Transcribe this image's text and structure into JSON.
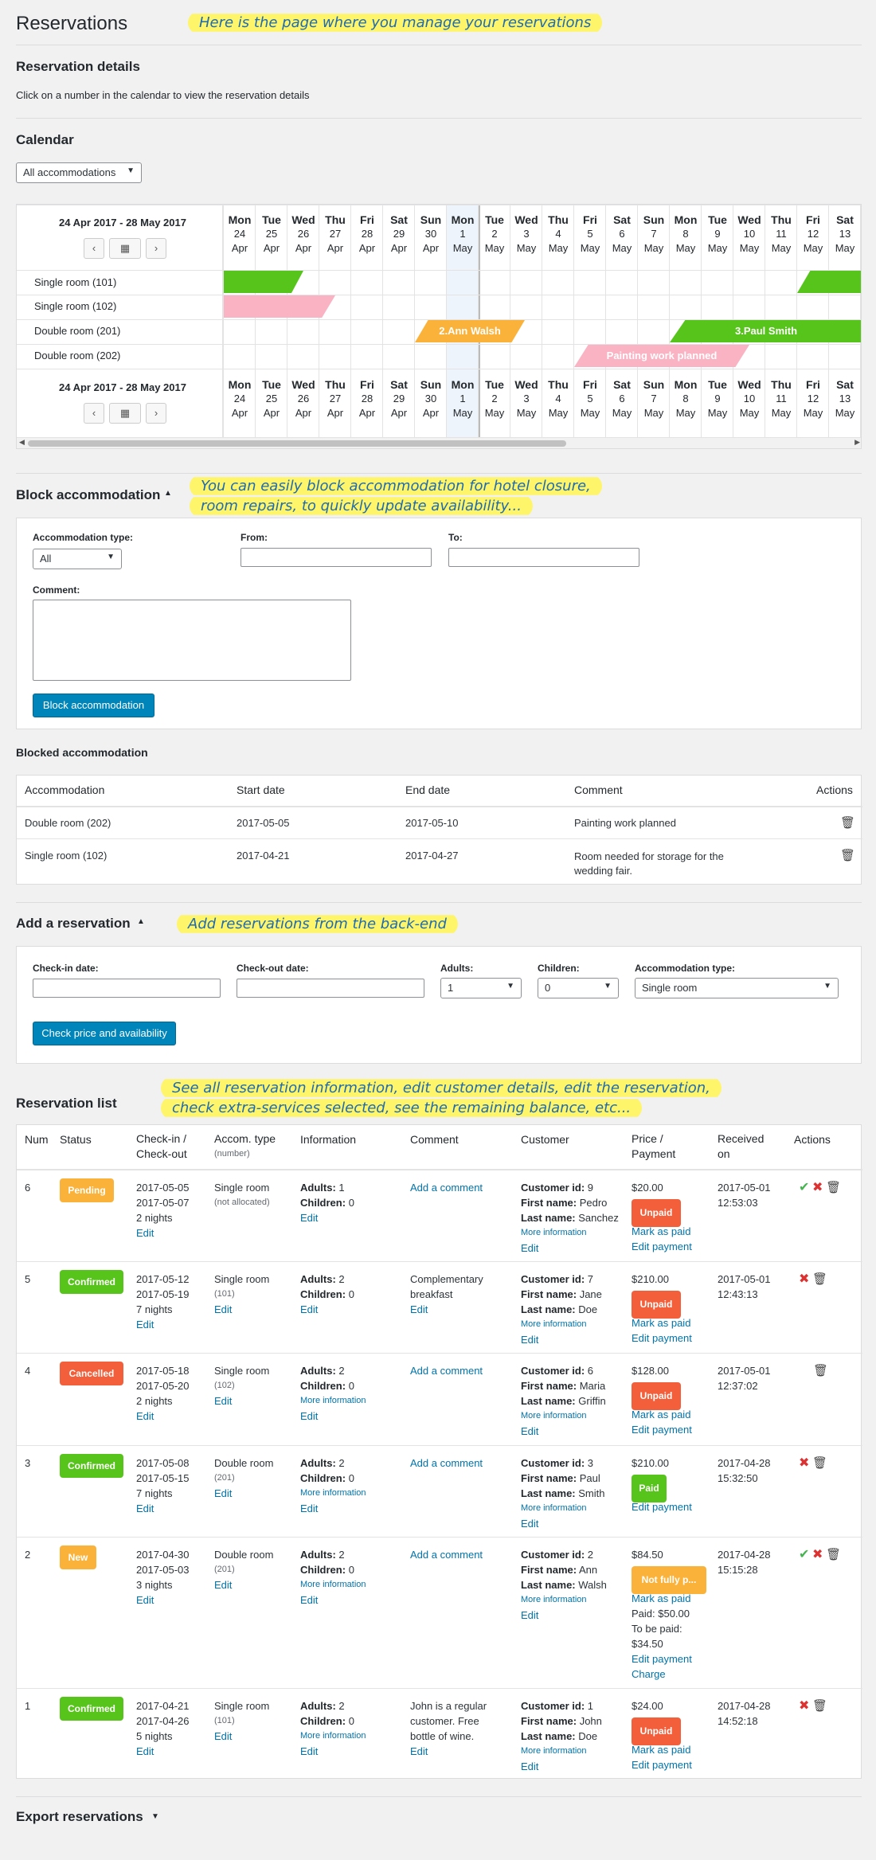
{
  "page": {
    "title": "Reservations",
    "title_note": "Here is the page where you manage your reservations"
  },
  "details": {
    "heading": "Reservation details",
    "hint": "Click on a number in the calendar to view the reservation details"
  },
  "calendar": {
    "heading": "Calendar",
    "filter": "All accommodations",
    "range": "24 Apr 2017 - 28 May 2017",
    "prev": "‹",
    "next": "›",
    "days": [
      {
        "dow": "Mon",
        "day": "24",
        "mon": "Apr"
      },
      {
        "dow": "Tue",
        "day": "25",
        "mon": "Apr"
      },
      {
        "dow": "Wed",
        "day": "26",
        "mon": "Apr"
      },
      {
        "dow": "Thu",
        "day": "27",
        "mon": "Apr"
      },
      {
        "dow": "Fri",
        "day": "28",
        "mon": "Apr"
      },
      {
        "dow": "Sat",
        "day": "29",
        "mon": "Apr"
      },
      {
        "dow": "Sun",
        "day": "30",
        "mon": "Apr"
      },
      {
        "dow": "Mon",
        "day": "1",
        "mon": "May"
      },
      {
        "dow": "Tue",
        "day": "2",
        "mon": "May"
      },
      {
        "dow": "Wed",
        "day": "3",
        "mon": "May"
      },
      {
        "dow": "Thu",
        "day": "4",
        "mon": "May"
      },
      {
        "dow": "Fri",
        "day": "5",
        "mon": "May"
      },
      {
        "dow": "Sat",
        "day": "6",
        "mon": "May"
      },
      {
        "dow": "Sun",
        "day": "7",
        "mon": "May"
      },
      {
        "dow": "Mon",
        "day": "8",
        "mon": "May"
      },
      {
        "dow": "Tue",
        "day": "9",
        "mon": "May"
      },
      {
        "dow": "Wed",
        "day": "10",
        "mon": "May"
      },
      {
        "dow": "Thu",
        "day": "11",
        "mon": "May"
      },
      {
        "dow": "Fri",
        "day": "12",
        "mon": "May"
      },
      {
        "dow": "Sat",
        "day": "13",
        "mon": "May"
      }
    ],
    "rooms": [
      "Single room (101)",
      "Single room (102)",
      "Double room (201)",
      "Double room (202)"
    ],
    "bar_labels": {
      "ann": "2.Ann Walsh",
      "paul": "3.Paul Smith",
      "painting": "Painting work planned"
    },
    "colors": {
      "green": "#56c41a",
      "pink": "#f9b3c2",
      "orange": "#fbb23a",
      "today": "#eef4fb"
    }
  },
  "block": {
    "heading": "Block accommodation",
    "note_line1": "You can easily block accommodation for hotel closure,",
    "note_line2": "room repairs, to quickly update availability...",
    "type_label": "Accommodation type:",
    "type_value": "All",
    "from_label": "From:",
    "to_label": "To:",
    "comment_label": "Comment:",
    "button": "Block accommodation"
  },
  "blocked": {
    "heading": "Blocked accommodation",
    "headers": [
      "Accommodation",
      "Start date",
      "End date",
      "Comment",
      "Actions"
    ],
    "rows": [
      {
        "acc": "Double room (202)",
        "start": "2017-05-05",
        "end": "2017-05-10",
        "comment1": "Painting work planned",
        "comment2": ""
      },
      {
        "acc": "Single room (102)",
        "start": "2017-04-21",
        "end": "2017-04-27",
        "comment1": "Room needed for storage for the",
        "comment2": "wedding fair."
      }
    ]
  },
  "add": {
    "heading": "Add a reservation",
    "note": "Add reservations from the back-end",
    "checkin_label": "Check-in date:",
    "checkout_label": "Check-out date:",
    "adults_label": "Adults:",
    "adults_value": "1",
    "children_label": "Children:",
    "children_value": "0",
    "type_label": "Accommodation type:",
    "type_value": "Single room",
    "button": "Check price and availability"
  },
  "list": {
    "heading": "Reservation list",
    "note_line1": "See all reservation information, edit customer details, edit the reservation,",
    "note_line2": "check extra-services selected, see the remaining balance, etc...",
    "headers": {
      "num": "Num",
      "status": "Status",
      "checkin1": "Check-in /",
      "checkin2": "Check-out",
      "accom1": "Accom. type",
      "accom2": "(number)",
      "info": "Information",
      "comment": "Comment",
      "customer": "Customer",
      "price1": "Price /",
      "price2": "Payment",
      "received1": "Received",
      "received2": "on",
      "actions": "Actions"
    },
    "labels": {
      "edit": "Edit",
      "add_comment": "Add a comment",
      "adults": "Adults:",
      "children": "Children:",
      "more_info": "More information",
      "customer_id": "Customer id:",
      "first_name": "First name:",
      "last_name": "Last name:",
      "mark_paid": "Mark as paid",
      "edit_payment": "Edit payment",
      "charge": "Charge"
    },
    "rows": [
      {
        "num": "6",
        "status": "Pending",
        "in": "2017-05-05",
        "out": "2017-05-07",
        "nights": "2 nights",
        "accom": "Single room",
        "accom_num": "(not allocated)",
        "adults": "1",
        "children": "0",
        "comment1": "",
        "comment2": "",
        "cid": "9",
        "first": "Pedro",
        "last": "Sanchez",
        "price": "$20.00",
        "payment": "Unpaid",
        "recv1": "2017-05-01",
        "recv2": "12:53:03"
      },
      {
        "num": "5",
        "status": "Confirmed",
        "in": "2017-05-12",
        "out": "2017-05-19",
        "nights": "7 nights",
        "accom": "Single room",
        "accom_num": "(101)",
        "adults": "2",
        "children": "0",
        "comment1": "Complementary",
        "comment2": "breakfast",
        "cid": "7",
        "first": "Jane",
        "last": "Doe",
        "price": "$210.00",
        "payment": "Unpaid",
        "recv1": "2017-05-01",
        "recv2": "12:43:13"
      },
      {
        "num": "4",
        "status": "Cancelled",
        "in": "2017-05-18",
        "out": "2017-05-20",
        "nights": "2 nights",
        "accom": "Single room",
        "accom_num": "(102)",
        "adults": "2",
        "children": "0",
        "comment1": "",
        "comment2": "",
        "cid": "6",
        "first": "Maria",
        "last": "Griffin",
        "price": "$128.00",
        "payment": "Unpaid",
        "recv1": "2017-05-01",
        "recv2": "12:37:02"
      },
      {
        "num": "3",
        "status": "Confirmed",
        "in": "2017-05-08",
        "out": "2017-05-15",
        "nights": "7 nights",
        "accom": "Double room",
        "accom_num": "(201)",
        "adults": "2",
        "children": "0",
        "comment1": "",
        "comment2": "",
        "cid": "3",
        "first": "Paul",
        "last": "Smith",
        "price": "$210.00",
        "payment": "Paid",
        "recv1": "2017-04-28",
        "recv2": "15:32:50"
      },
      {
        "num": "2",
        "status": "New",
        "in": "2017-04-30",
        "out": "2017-05-03",
        "nights": "3 nights",
        "accom": "Double room",
        "accom_num": "(201)",
        "adults": "2",
        "children": "0",
        "comment1": "",
        "comment2": "",
        "cid": "2",
        "first": "Ann",
        "last": "Walsh",
        "price": "$84.50",
        "payment": "Not fully p...",
        "paid_line": "Paid: $50.00",
        "tobe_line1": "To be paid:",
        "tobe_line2": "$34.50",
        "recv1": "2017-04-28",
        "recv2": "15:15:28"
      },
      {
        "num": "1",
        "status": "Confirmed",
        "in": "2017-04-21",
        "out": "2017-04-26",
        "nights": "5 nights",
        "accom": "Single room",
        "accom_num": "(101)",
        "adults": "2",
        "children": "0",
        "comment1": "John is a regular",
        "comment2": "customer. Free",
        "comment3": "bottle of wine.",
        "cid": "1",
        "first": "John",
        "last": "Doe",
        "price": "$24.00",
        "payment": "Unpaid",
        "recv1": "2017-04-28",
        "recv2": "14:52:18"
      }
    ],
    "colors": {
      "pending": "#fbb23a",
      "confirmed": "#56c41a",
      "cancelled": "#f25f3a",
      "new": "#fbb23a",
      "unpaid": "#f25f3a",
      "paid": "#56c41a",
      "partial": "#fbb23a"
    }
  },
  "export": {
    "heading": "Export reservations"
  }
}
